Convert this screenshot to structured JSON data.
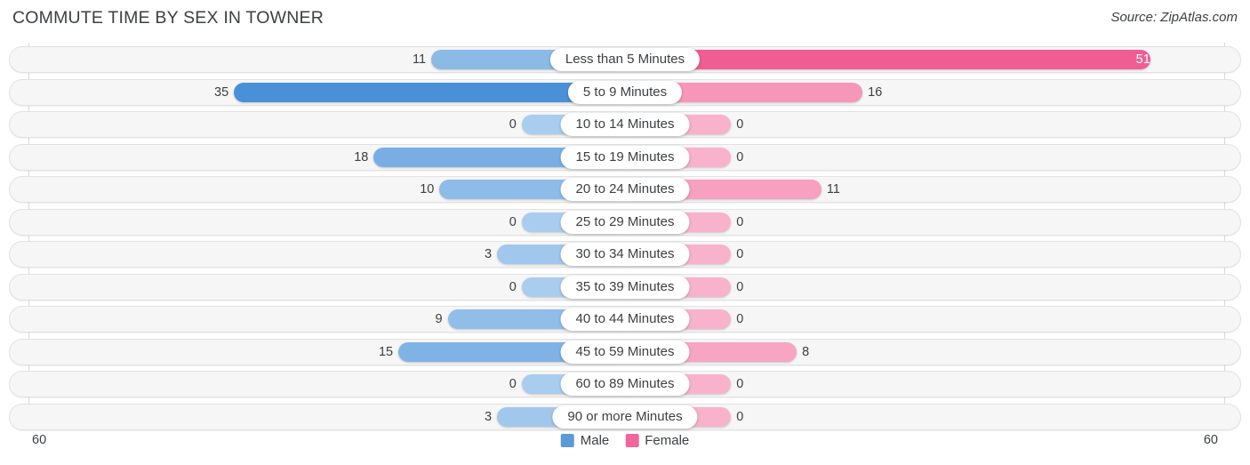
{
  "header": {
    "title": "COMMUTE TIME BY SEX IN TOWNER",
    "source": "Source: ZipAtlas.com"
  },
  "axis": {
    "left_tick": "60",
    "right_tick": "60",
    "max": 60
  },
  "legend": {
    "items": [
      {
        "label": "Male",
        "color": "#5b9bd5"
      },
      {
        "label": "Female",
        "color": "#f2669a"
      }
    ]
  },
  "colors": {
    "male_min": "#a9cdee",
    "male_max": "#4a90d9",
    "female_min": "#f9b2cb",
    "female_max": "#ef5d93",
    "track": "#f6f6f6",
    "track_border": "#e2e2e2",
    "axis_line": "#d8d8d8",
    "text": "#3c4043"
  },
  "chart_data": {
    "type": "bar",
    "orientation": "horizontal",
    "layout": "diverging-bidirectional",
    "title": "COMMUTE TIME BY SEX IN TOWNER",
    "xlabel": "",
    "ylabel": "",
    "xlim": [
      60,
      60
    ],
    "grid": false,
    "legend_position": "bottom-center",
    "categories": [
      "Less than 5 Minutes",
      "5 to 9 Minutes",
      "10 to 14 Minutes",
      "15 to 19 Minutes",
      "20 to 24 Minutes",
      "25 to 29 Minutes",
      "30 to 34 Minutes",
      "35 to 39 Minutes",
      "40 to 44 Minutes",
      "45 to 59 Minutes",
      "60 to 89 Minutes",
      "90 or more Minutes"
    ],
    "series": [
      {
        "name": "Male",
        "side": "left",
        "values": [
          11,
          35,
          0,
          18,
          10,
          0,
          3,
          0,
          9,
          15,
          0,
          3
        ],
        "labels": [
          "11",
          "35",
          "0",
          "18",
          "10",
          "0",
          "3",
          "0",
          "9",
          "15",
          "0",
          "3"
        ]
      },
      {
        "name": "Female",
        "side": "right",
        "values": [
          51,
          16,
          0,
          0,
          11,
          0,
          0,
          0,
          0,
          8,
          0,
          0
        ],
        "labels": [
          "51",
          "16",
          "0",
          "0",
          "11",
          "0",
          "0",
          "0",
          "0",
          "8",
          "0",
          "0"
        ]
      }
    ]
  }
}
